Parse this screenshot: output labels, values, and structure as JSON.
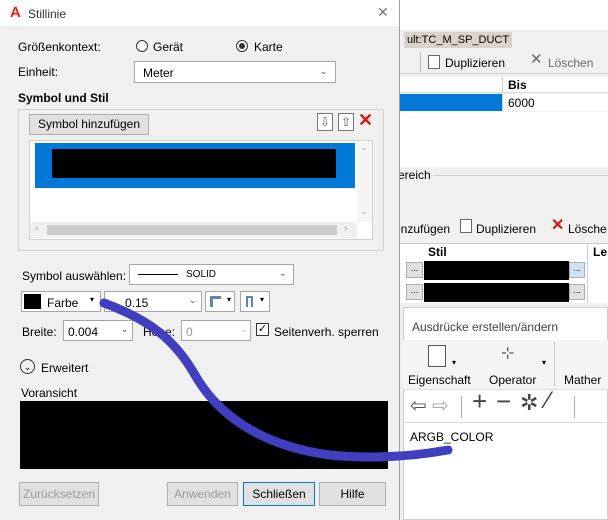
{
  "dialog": {
    "title": "Stillinie",
    "close_glyph": "✕",
    "scale_context_label": "Größenkontext:",
    "scale_options": [
      {
        "label": "Gerät",
        "selected": false
      },
      {
        "label": "Karte",
        "selected": true
      }
    ],
    "unit_label": "Einheit:",
    "unit_value": "Meter",
    "section_title": "Symbol und Stil",
    "add_symbol_button": "Symbol hinzufügen",
    "select_symbol_label": "Symbol auswählen:",
    "select_symbol_value": "SOLID",
    "color_label": "Farbe",
    "line_width_value": "0.15",
    "width_label": "Breite:",
    "width_value": "0.004",
    "height_label": "Höhe:",
    "height_value": "0",
    "lock_aspect_label": "Seitenverh. sperren",
    "lock_aspect_checked": true,
    "advanced_label": "Erweitert",
    "preview_label": "Voransicht",
    "buttons": {
      "reset": "Zurücksetzen",
      "apply": "Anwenden",
      "close": "Schließen",
      "help": "Hilfe"
    }
  },
  "background": {
    "style_name": "ult:TC_M_SP_DUCT",
    "duplicate_button": "Duplizieren",
    "delete_button": "Löschen",
    "col_bis": "Bis",
    "bis_value": "6000",
    "range_label": "ereich",
    "add_button_partial": "inzufügen",
    "duplicate_button2": "Duplizieren",
    "delete_button2": "Lösche",
    "col_stil": "Stil",
    "col_le": "Le",
    "expr_title": "Ausdrücke erstellen/ändern",
    "toolbar": [
      "Eigenschaft",
      "Operator",
      "Mather"
    ],
    "expression_text": "ARGB_COLOR"
  },
  "colors": {
    "accent": "#0078d7",
    "annotation": "#3f3fbf",
    "autodesk_red": "#e2231a"
  }
}
